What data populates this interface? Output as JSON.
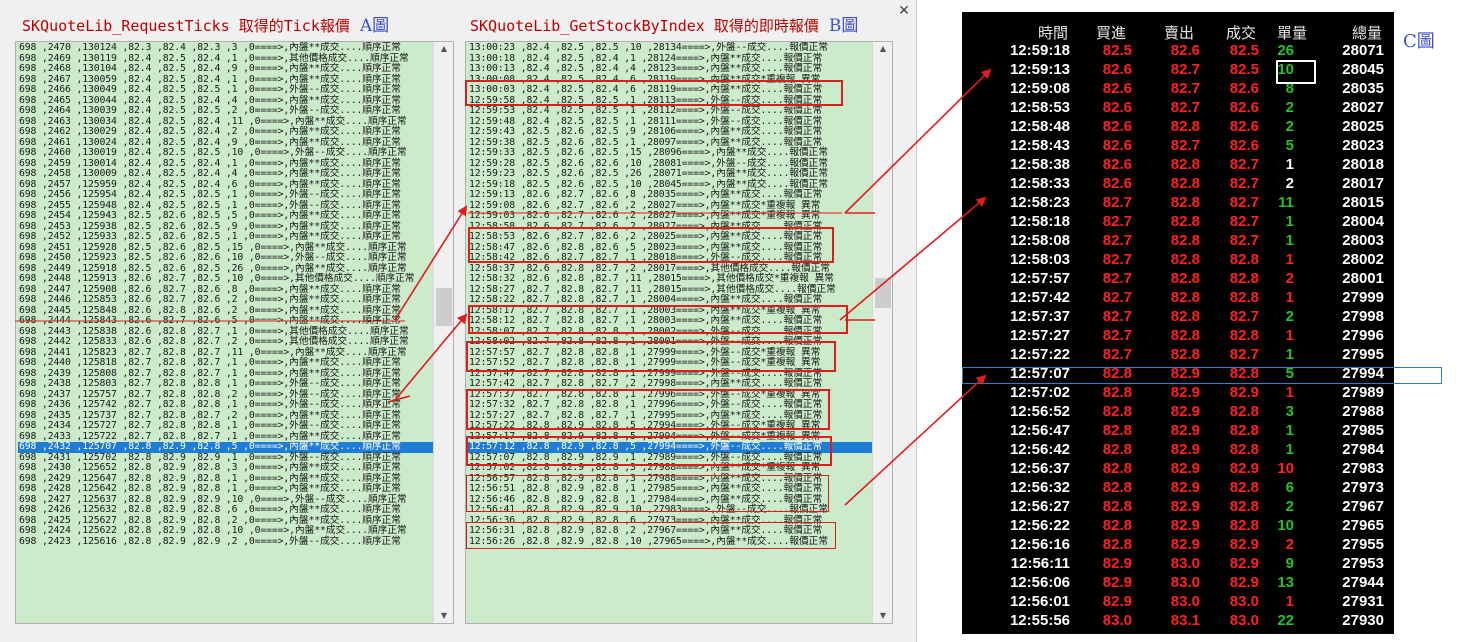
{
  "titles": {
    "a": "SKQuoteLib_RequestTicks 取得的Tick報價",
    "a_fig": "A圖",
    "b": "SKQuoteLib_GetStockByIndex 取得的即時報價",
    "b_fig": "B圖",
    "c_fig": "C圖",
    "close_symbol": "✕"
  },
  "list_a": [
    "698 ,2470 ,130124 ,82.3 ,82.4 ,82.3 ,3 ,0====>,內盤**成交....順序正常",
    "698 ,2469 ,130119 ,82.4 ,82.5 ,82.4 ,1 ,0====>,其他價格成交....順序正常",
    "698 ,2468 ,130104 ,82.4 ,82.5 ,82.4 ,9 ,0====>,內盤**成交....順序正常",
    "698 ,2467 ,130059 ,82.4 ,82.5 ,82.4 ,1 ,0====>,內盤**成交....順序正常",
    "698 ,2466 ,130049 ,82.4 ,82.5 ,82.5 ,1 ,0====>,外盤--成交....順序正常",
    "698 ,2465 ,130044 ,82.4 ,82.5 ,82.4 ,4 ,0====>,內盤**成交....順序正常",
    "698 ,2464 ,130039 ,82.4 ,82.5 ,82.5 ,2 ,0====>,外盤--成交....順序正常",
    "698 ,2463 ,130034 ,82.4 ,82.5 ,82.4 ,11 ,0====>,內盤**成交....順序正常",
    "698 ,2462 ,130029 ,82.4 ,82.5 ,82.4 ,2 ,0====>,內盤**成交....順序正常",
    "698 ,2461 ,130024 ,82.4 ,82.5 ,82.4 ,9 ,0====>,內盤**成交....順序正常",
    "698 ,2460 ,130019 ,82.4 ,82.5 ,82.5 ,10 ,0====>,外盤--成交....順序正常",
    "698 ,2459 ,130014 ,82.4 ,82.5 ,82.4 ,1 ,0====>,內盤**成交....順序正常",
    "698 ,2458 ,130009 ,82.4 ,82.5 ,82.4 ,4 ,0====>,內盤**成交....順序正常",
    "698 ,2457 ,125959 ,82.4 ,82.5 ,82.4 ,6 ,0====>,內盤**成交....順序正常",
    "698 ,2456 ,125954 ,82.4 ,82.5 ,82.5 ,1 ,0====>,外盤--成交....順序正常",
    "698 ,2455 ,125948 ,82.4 ,82.5 ,82.5 ,1 ,0====>,外盤--成交....順序正常",
    "698 ,2454 ,125943 ,82.5 ,82.6 ,82.5 ,5 ,0====>,內盤**成交....順序正常",
    "698 ,2453 ,125938 ,82.5 ,82.6 ,82.5 ,9 ,0====>,內盤**成交....順序正常",
    "698 ,2452 ,125933 ,82.5 ,82.6 ,82.5 ,1 ,0====>,內盤**成交....順序正常",
    "698 ,2451 ,125928 ,82.5 ,82.6 ,82.5 ,15 ,0====>,內盤**成交....順序正常",
    "698 ,2450 ,125923 ,82.5 ,82.6 ,82.6 ,10 ,0====>,外盤--成交....順序正常",
    "698 ,2449 ,125918 ,82.5 ,82.6 ,82.5 ,26 ,0====>,內盤**成交....順序正常",
    "698 ,2448 ,125913 ,82.6 ,82.7 ,82.5 ,10 ,0====>,其他價格成交....順序正常",
    "698 ,2447 ,125908 ,82.6 ,82.7 ,82.6 ,8 ,0====>,內盤**成交....順序正常",
    "698 ,2446 ,125853 ,82.6 ,82.7 ,82.6 ,2 ,0====>,內盤**成交....順序正常",
    "698 ,2445 ,125848 ,82.6 ,82.8 ,82.6 ,2 ,0====>,內盤**成交....順序正常",
    "698 ,2444 ,125843 ,82.6 ,82.7 ,82.6 ,5 ,0====>,內盤**成交....順序正常",
    "698 ,2443 ,125838 ,82.6 ,82.8 ,82.7 ,1 ,0====>,其他價格成交....順序正常",
    "698 ,2442 ,125833 ,82.6 ,82.8 ,82.7 ,2 ,0====>,其他價格成交....順序正常",
    "698 ,2441 ,125823 ,82.7 ,82.8 ,82.7 ,11 ,0====>,內盤**成交....順序正常",
    "698 ,2440 ,125818 ,82.7 ,82.8 ,82.7 ,1 ,0====>,內盤**成交....順序正常",
    "698 ,2439 ,125808 ,82.7 ,82.8 ,82.7 ,1 ,0====>,內盤**成交....順序正常",
    "698 ,2438 ,125803 ,82.7 ,82.8 ,82.8 ,1 ,0====>,外盤--成交....順序正常",
    "698 ,2437 ,125757 ,82.7 ,82.8 ,82.8 ,2 ,0====>,外盤--成交....順序正常",
    "698 ,2436 ,125742 ,82.7 ,82.8 ,82.8 ,1 ,0====>,外盤--成交....順序正常",
    "698 ,2435 ,125737 ,82.7 ,82.8 ,82.7 ,2 ,0====>,內盤**成交....順序正常",
    "698 ,2434 ,125727 ,82.7 ,82.8 ,82.8 ,1 ,0====>,外盤--成交....順序正常",
    "698 ,2433 ,125722 ,82.7 ,82.8 ,82.7 ,1 ,0====>,內盤**成交....順序正常",
    "698 ,2432 ,125707 ,82.8 ,82.9 ,82.8 ,5 ,0====>,內盤**成交....順序正常",
    "698 ,2431 ,125702 ,82.8 ,82.9 ,82.9 ,1 ,0====>,外盤--成交....順序正常",
    "698 ,2430 ,125652 ,82.8 ,82.9 ,82.8 ,3 ,0====>,內盤**成交....順序正常",
    "698 ,2429 ,125647 ,82.8 ,82.9 ,82.8 ,1 ,0====>,內盤**成交....順序正常",
    "698 ,2428 ,125642 ,82.8 ,82.9 ,82.8 ,1 ,0====>,內盤**成交....順序正常",
    "698 ,2427 ,125637 ,82.8 ,82.9 ,82.9 ,10 ,0====>,外盤--成交....順序正常",
    "698 ,2426 ,125632 ,82.8 ,82.9 ,82.8 ,6 ,0====>,內盤**成交....順序正常",
    "698 ,2425 ,125627 ,82.8 ,82.9 ,82.8 ,2 ,0====>,內盤**成交....順序正常",
    "698 ,2424 ,125622 ,82.8 ,82.9 ,82.8 ,10 ,0====>,內盤**成交....順序正常",
    "698 ,2423 ,125616 ,82.8 ,82.9 ,82.9 ,2 ,0====>,外盤--成交....順序正常"
  ],
  "list_a_selected_index": 38,
  "list_b": [
    "13:00:23 ,82.4 ,82.5 ,82.5 ,10 ,28134====>,外盤--成交....報價正常",
    "13:00:18 ,82.4 ,82.5 ,82.4 ,1 ,28124====>,內盤**成交....報價正常",
    "13:00:13 ,82.4 ,82.5 ,82.4 ,4 ,28123====>,內盤**成交....報價正常",
    "13:00:08 ,82.4 ,82.5 ,82.4 ,6 ,28119====>,內盤**成交*重複報 異常",
    "13:00:03 ,82.4 ,82.5 ,82.4 ,6 ,28119====>,內盤**成交....報價正常",
    "12:59:58 ,82.4 ,82.5 ,82.5 ,1 ,28113====>,外盤--成交....報價正常",
    "12:59:53 ,82.4 ,82.5 ,82.5 ,1 ,28112====>,外盤--成交....報價正常",
    "12:59:48 ,82.4 ,82.5 ,82.5 ,1 ,28111====>,外盤--成交....報價正常",
    "12:59:43 ,82.5 ,82.6 ,82.5 ,9 ,28106====>,內盤**成交....報價正常",
    "12:59:38 ,82.5 ,82.6 ,82.5 ,1 ,28097====>,內盤**成交....報價正常",
    "12:59:33 ,82.5 ,82.6 ,82.5 ,15 ,28096====>,內盤**成交....報價正常",
    "12:59:28 ,82.5 ,82.6 ,82.6 ,10 ,28081====>,外盤--成交....報價正常",
    "12:59:23 ,82.5 ,82.6 ,82.5 ,26 ,28071====>,內盤**成交....報價正常",
    "12:59:18 ,82.5 ,82.6 ,82.5 ,10 ,28045====>,內盤**成交....報價正常",
    "12:59:13 ,82.6 ,82.7 ,82.6 ,8 ,28035====>,內盤**成交....報價正常",
    "12:59:08 ,82.6 ,82.7 ,82.6 ,2 ,28027====>,內盤**成交*重複報 異常",
    "12:59:03 ,82.6 ,82.7 ,82.6 ,2 ,28027====>,內盤**成交*重複報 異常",
    "12:58:58 ,82.6 ,82.7 ,82.6 ,2 ,28027====>,內盤**成交....報價正常",
    "12:58:53 ,82.6 ,82.7 ,82.6 ,2 ,28025====>,內盤**成交....報價正常",
    "12:58:47 ,82.6 ,82.8 ,82.6 ,5 ,28023====>,內盤**成交....報價正常",
    "12:58:42 ,82.6 ,82.7 ,82.7 ,1 ,28018====>,外盤--成交....報價正常",
    "12:58:37 ,82.6 ,82.8 ,82.7 ,2 ,28017====>,其他價格成交....報價正常",
    "12:58:32 ,82.6 ,82.8 ,82.7 ,11 ,28015====>,其他價格成交*重複報 異常",
    "12:58:27 ,82.7 ,82.8 ,82.7 ,11 ,28015====>,其他價格成交....報價正常",
    "12:58:22 ,82.7 ,82.8 ,82.7 ,1 ,28004====>,內盤**成交....報價正常",
    "12:58:17 ,82.7 ,82.8 ,82.7 ,1 ,28003====>,內盤**成交*重複報 異常",
    "12:58:12 ,82.7 ,82.8 ,82.7 ,1 ,28003====>,內盤**成交....報價正常",
    "12:58:07 ,82.7 ,82.8 ,82.8 ,1 ,28002====>,外盤--成交....報價正常",
    "12:58:02 ,82.7 ,82.8 ,82.8 ,1 ,28001====>,外盤--成交....報價正常",
    "12:57:57 ,82.7 ,82.8 ,82.8 ,1 ,27999====>,外盤--成交*重複報 異常",
    "12:57:52 ,82.7 ,82.8 ,82.8 ,1 ,27999====>,外盤--成交*重複報 異常",
    "12:57:47 ,82.7 ,82.8 ,82.8 ,1 ,27999====>,外盤--成交....報價正常",
    "12:57:42 ,82.7 ,82.8 ,82.7 ,2 ,27998====>,內盤**成交....報價正常",
    "12:57:37 ,82.7 ,82.8 ,82.8 ,1 ,27996====>,外盤--成交*重複報 異常",
    "12:57:32 ,82.7 ,82.8 ,82.8 ,1 ,27996====>,外盤--成交....報價正常",
    "12:57:27 ,82.7 ,82.8 ,82.7 ,1 ,27995====>,內盤**成交....報價正常",
    "12:57:22 ,82.8 ,82.9 ,82.8 ,5 ,27994====>,外盤--成交*重複報 異常",
    "12:57:17 ,82.8 ,82.9 ,82.8 ,5 ,27994====>,外盤--成交*重複報 異常",
    "12:57:12 ,82.8 ,82.9 ,82.8 ,5 ,27994====>,外盤--成交....報價正常",
    "12:57:07 ,82.8 ,82.9 ,82.9 ,1 ,27989====>,外盤--成交....報價正常",
    "12:57:02 ,82.8 ,82.9 ,82.8 ,3 ,27988====>,內盤**成交*重複報 異常",
    "12:56:57 ,82.8 ,82.9 ,82.8 ,3 ,27988====>,內盤**成交....報價正常",
    "12:56:51 ,82.8 ,82.9 ,82.8 ,1 ,27985====>,內盤**成交....報價正常",
    "12:56:46 ,82.8 ,82.9 ,82.8 ,1 ,27984====>,內盤**成交....報價正常",
    "12:56:41 ,82.8 ,82.9 ,82.9 ,10 ,27983====>,外盤--成交....報價正常",
    "12:56:36 ,82.8 ,82.9 ,82.8 ,6 ,27973====>,內盤**成交....報價正常",
    "12:56:31 ,82.8 ,82.9 ,82.8 ,2 ,27967====>,內盤**成交....報價正常",
    "12:56:26 ,82.8 ,82.9 ,82.8 ,10 ,27965====>,內盤**成交....報價正常"
  ],
  "list_b_selected_index": 38,
  "table_c": {
    "headers": [
      "時間",
      "買進",
      "賣出",
      "成交",
      "單量",
      "總量"
    ],
    "rows": [
      [
        "12:59:18",
        "82.5",
        "82.6",
        "82.5",
        "26",
        "28071"
      ],
      [
        "12:59:13",
        "82.6",
        "82.7",
        "82.5",
        "10",
        "28045"
      ],
      [
        "12:59:08",
        "82.6",
        "82.7",
        "82.6",
        "8",
        "28035"
      ],
      [
        "12:58:53",
        "82.6",
        "82.7",
        "82.6",
        "2",
        "28027"
      ],
      [
        "12:58:48",
        "82.6",
        "82.8",
        "82.6",
        "2",
        "28025"
      ],
      [
        "12:58:43",
        "82.6",
        "82.7",
        "82.6",
        "5",
        "28023"
      ],
      [
        "12:58:38",
        "82.6",
        "82.8",
        "82.7",
        "1",
        "28018"
      ],
      [
        "12:58:33",
        "82.6",
        "82.8",
        "82.7",
        "2",
        "28017"
      ],
      [
        "12:58:23",
        "82.7",
        "82.8",
        "82.7",
        "11",
        "28015"
      ],
      [
        "12:58:18",
        "82.7",
        "82.8",
        "82.7",
        "1",
        "28004"
      ],
      [
        "12:58:08",
        "82.7",
        "82.8",
        "82.7",
        "1",
        "28003"
      ],
      [
        "12:58:03",
        "82.7",
        "82.8",
        "82.8",
        "1",
        "28002"
      ],
      [
        "12:57:57",
        "82.7",
        "82.8",
        "82.8",
        "2",
        "28001"
      ],
      [
        "12:57:42",
        "82.7",
        "82.8",
        "82.8",
        "1",
        "27999"
      ],
      [
        "12:57:37",
        "82.7",
        "82.8",
        "82.7",
        "2",
        "27998"
      ],
      [
        "12:57:27",
        "82.7",
        "82.8",
        "82.8",
        "1",
        "27996"
      ],
      [
        "12:57:22",
        "82.7",
        "82.8",
        "82.7",
        "1",
        "27995"
      ],
      [
        "12:57:07",
        "82.8",
        "82.9",
        "82.8",
        "5",
        "27994"
      ],
      [
        "12:57:02",
        "82.8",
        "82.9",
        "82.9",
        "1",
        "27989"
      ],
      [
        "12:56:52",
        "82.8",
        "82.9",
        "82.8",
        "3",
        "27988"
      ],
      [
        "12:56:47",
        "82.8",
        "82.9",
        "82.8",
        "1",
        "27985"
      ],
      [
        "12:56:42",
        "82.8",
        "82.9",
        "82.8",
        "1",
        "27984"
      ],
      [
        "12:56:37",
        "82.8",
        "82.9",
        "82.9",
        "10",
        "27983"
      ],
      [
        "12:56:32",
        "82.8",
        "82.9",
        "82.8",
        "6",
        "27973"
      ],
      [
        "12:56:27",
        "82.8",
        "82.9",
        "82.8",
        "2",
        "27967"
      ],
      [
        "12:56:22",
        "82.8",
        "82.9",
        "82.8",
        "10",
        "27965"
      ],
      [
        "12:56:16",
        "82.8",
        "82.9",
        "82.9",
        "2",
        "27955"
      ],
      [
        "12:56:11",
        "82.9",
        "83.0",
        "82.9",
        "9",
        "27953"
      ],
      [
        "12:56:06",
        "82.9",
        "83.0",
        "82.9",
        "13",
        "27944"
      ],
      [
        "12:56:01",
        "82.9",
        "83.0",
        "83.0",
        "1",
        "27931"
      ],
      [
        "12:55:56",
        "83.0",
        "83.1",
        "83.0",
        "22",
        "27930"
      ]
    ],
    "vol_colors": [
      "green",
      "green",
      "green",
      "green",
      "green",
      "green",
      "white",
      "white",
      "green",
      "green",
      "green",
      "red",
      "red",
      "red",
      "green",
      "red",
      "green",
      "green",
      "red",
      "green",
      "green",
      "green",
      "red",
      "green",
      "green",
      "green",
      "red",
      "green",
      "green",
      "red",
      "green"
    ]
  },
  "colors": {
    "red": "#ff2020",
    "green": "#22c322",
    "white": "#ffffff",
    "highlight": "#e21b1b",
    "selection": "#1e7bd6"
  }
}
